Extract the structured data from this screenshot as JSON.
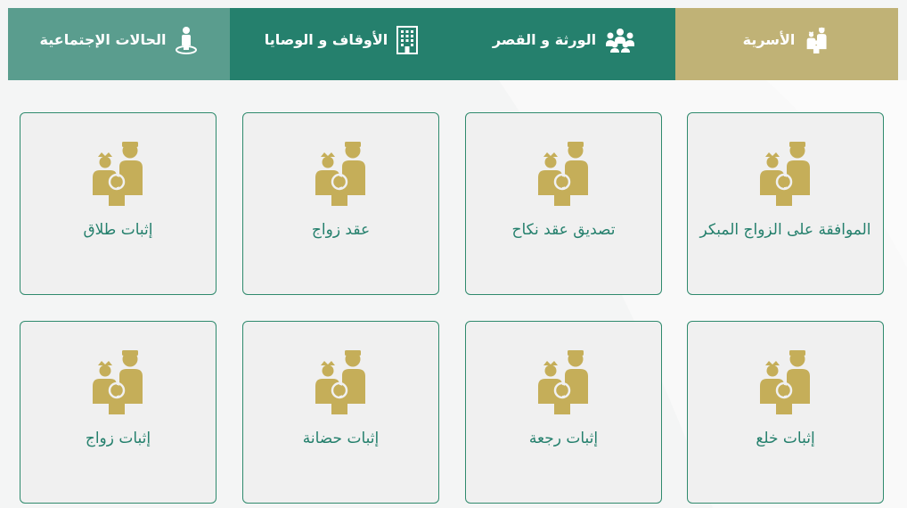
{
  "tabs": [
    {
      "label": "الأسرية",
      "icon": "family-icon",
      "active": true
    },
    {
      "label": "الورثة و القصر",
      "icon": "group-people-icon"
    },
    {
      "label": "الأوقاف و الوصايا",
      "icon": "building-icon"
    },
    {
      "label": "الحالات الإجتماعية",
      "icon": "person-on-base-icon"
    }
  ],
  "cards": [
    {
      "label": "الموافقة على الزواج المبكر",
      "icon": "family-icon"
    },
    {
      "label": "تصديق عقد نكاح",
      "icon": "family-icon"
    },
    {
      "label": "عقد زواج",
      "icon": "family-icon"
    },
    {
      "label": "إثبات طلاق",
      "icon": "family-icon"
    },
    {
      "label": "إثبات خلع",
      "icon": "family-icon"
    },
    {
      "label": "إثبات رجعة",
      "icon": "family-icon"
    },
    {
      "label": "إثبات حضانة",
      "icon": "family-icon"
    },
    {
      "label": "إثبات زواج",
      "icon": "family-icon"
    }
  ],
  "colors": {
    "gold": "#c0b276",
    "green": "#25806d",
    "teal": "#5a9d8e",
    "icon_gold": "#c5ae59",
    "card_bg": "#f0f0f0"
  }
}
